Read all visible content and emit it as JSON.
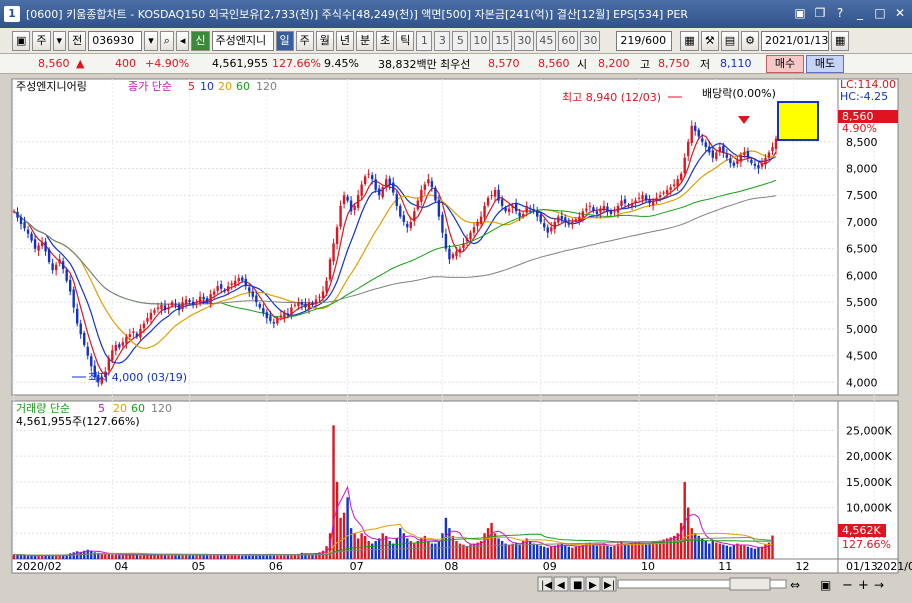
{
  "window": {
    "number": "1",
    "title": "[0600] 키움종합차트 - KOSDAQ150 외국인보유[2,733(천)] 주식수[48,249(천)] 액면[500] 자본금[241(억)] 결산[12월] EPS[534] PER"
  },
  "toolbar": {
    "market": "주",
    "jeon": "전",
    "code": "036930",
    "sin": "신",
    "stock_name": "주성엔지니",
    "periods": [
      "일",
      "주",
      "월",
      "년",
      "분",
      "초",
      "틱"
    ],
    "active_period": "일",
    "numbers": [
      "1",
      "3",
      "5",
      "10",
      "15",
      "30",
      "45",
      "60",
      "30"
    ],
    "count": "219/600",
    "date": "2021/01/13"
  },
  "quote": {
    "price": "8,560",
    "change": "400",
    "change_pct": "+4.90%",
    "volume": "4,561,955",
    "vol_ratio": "127.66%",
    "turnover": "9.45%",
    "amount": "38,832백만",
    "best_label": "최우선",
    "best_ask": "8,570",
    "best_bid": "8,560",
    "open_label": "시",
    "open": "8,200",
    "high_label": "고",
    "high": "8,750",
    "low_label": "저",
    "low": "8,110",
    "buy": "매수",
    "sell": "매도"
  },
  "price_panel": {
    "stock_label": "주성엔지니어링",
    "ma_label": "종가 단순",
    "ma_periods": [
      "5",
      "10",
      "20",
      "60",
      "120"
    ],
    "ma_colors": [
      "#e0141e",
      "#1232c8",
      "#e0a000",
      "#14a014",
      "#808080"
    ],
    "lc": "LC:114.00",
    "hc": "HC:-4.25",
    "current_price": "8,560",
    "current_pct": "4.90%",
    "high_annotation": "최고 8,940 (12/03)",
    "low_annotation": "최저 4,000 (03/19)",
    "dividend_annotation": "배당락(0.00%)"
  },
  "volume_panel": {
    "label": "거래량 단순",
    "ma_periods": [
      "5",
      "20",
      "60",
      "120"
    ],
    "ma_colors": [
      "#c814c8",
      "#e0a000",
      "#14a014",
      "#808080"
    ],
    "current": "4,561,955주(127.66%)",
    "current_short": "4,562K",
    "current_pct": "127.66%"
  },
  "chart_data": {
    "type": "candlestick",
    "price_ticks": [
      "8,500",
      "8,000",
      "7,500",
      "7,000",
      "6,500",
      "6,000",
      "5,500",
      "5,000",
      "4,500",
      "4,000"
    ],
    "price_tick_values": [
      8500,
      8000,
      7500,
      7000,
      6500,
      6000,
      5500,
      5000,
      4500,
      4000
    ],
    "price_range": [
      3800,
      9300
    ],
    "volume_ticks": [
      "25,000K",
      "20,000K",
      "15,000K",
      "10,000K",
      "5,000K"
    ],
    "volume_tick_values": [
      25000,
      20000,
      15000,
      10000,
      5000
    ],
    "volume_range": [
      0,
      28000
    ],
    "x_labels": [
      "2020/02",
      "04",
      "05",
      "06",
      "07",
      "08",
      "09",
      "10",
      "11",
      "12",
      "2021/01"
    ],
    "x_label_index": [
      0,
      28,
      50,
      72,
      95,
      122,
      150,
      178,
      200,
      222,
      245
    ],
    "right_x_label": "01/13",
    "close": [
      7200,
      7080,
      6960,
      6880,
      6780,
      6650,
      6500,
      6560,
      6620,
      6450,
      6250,
      6100,
      6200,
      6300,
      6120,
      5900,
      5700,
      5400,
      5100,
      4900,
      4700,
      4500,
      4300,
      4100,
      4000,
      4100,
      4200,
      4450,
      4600,
      4700,
      4650,
      4750,
      4850,
      4900,
      4950,
      4850,
      5000,
      5100,
      5200,
      5300,
      5350,
      5400,
      5450,
      5350,
      5400,
      5500,
      5450,
      5350,
      5500,
      5550,
      5500,
      5450,
      5500,
      5600,
      5550,
      5500,
      5650,
      5700,
      5800,
      5750,
      5700,
      5800,
      5850,
      5900,
      5950,
      5900,
      5800,
      5700,
      5600,
      5500,
      5400,
      5300,
      5200,
      5150,
      5100,
      5200,
      5250,
      5300,
      5250,
      5400,
      5450,
      5500,
      5450,
      5400,
      5500,
      5450,
      5550,
      5600,
      5700,
      5900,
      6300,
      6600,
      6900,
      7300,
      7500,
      7400,
      7200,
      7300,
      7500,
      7700,
      7850,
      7900,
      7800,
      7600,
      7500,
      7650,
      7800,
      7700,
      7550,
      7300,
      7100,
      7000,
      6900,
      7000,
      7200,
      7400,
      7600,
      7700,
      7800,
      7650,
      7400,
      7100,
      6800,
      6500,
      6300,
      6400,
      6450,
      6500,
      6600,
      6700,
      6800,
      6900,
      7000,
      7100,
      7300,
      7450,
      7500,
      7600,
      7400,
      7300,
      7200,
      7250,
      7300,
      7200,
      7100,
      7150,
      7300,
      7250,
      7200,
      7100,
      7000,
      6900,
      6800,
      6900,
      7000,
      7100,
      7050,
      7000,
      6950,
      7000,
      7050,
      7100,
      7200,
      7250,
      7300,
      7200,
      7150,
      7250,
      7300,
      7200,
      7150,
      7200,
      7300,
      7400,
      7350,
      7300,
      7350,
      7400,
      7450,
      7500,
      7400,
      7350,
      7400,
      7450,
      7500,
      7550,
      7600,
      7650,
      7700,
      7800,
      7900,
      8200,
      8500,
      8800,
      8700,
      8600,
      8500,
      8400,
      8300,
      8200,
      8300,
      8400,
      8300,
      8200,
      8100,
      8050,
      8150,
      8250,
      8300,
      8200,
      8100,
      8050,
      8000,
      8100,
      8200,
      8300,
      8400,
      8560
    ],
    "volume": [
      900,
      800,
      750,
      700,
      650,
      700,
      650,
      600,
      700,
      650,
      750,
      800,
      700,
      650,
      800,
      900,
      1100,
      1300,
      1500,
      1400,
      1600,
      1800,
      1500,
      1300,
      1200,
      1100,
      1000,
      900,
      850,
      800,
      750,
      700,
      800,
      850,
      900,
      800,
      700,
      750,
      800,
      850,
      900,
      850,
      800,
      750,
      700,
      800,
      850,
      900,
      800,
      750,
      700,
      700,
      750,
      800,
      850,
      800,
      750,
      700,
      800,
      850,
      900,
      850,
      800,
      750,
      700,
      650,
      700,
      750,
      700,
      650,
      700,
      750,
      800,
      850,
      900,
      800,
      750,
      700,
      800,
      850,
      900,
      1000,
      1200,
      1100,
      1000,
      900,
      1100,
      1300,
      1600,
      2500,
      5000,
      26000,
      15000,
      8000,
      9000,
      12000,
      6000,
      5000,
      4000,
      5000,
      4500,
      3500,
      3000,
      3500,
      4000,
      5000,
      4500,
      3500,
      3000,
      4000,
      6000,
      5000,
      4000,
      3500,
      3000,
      3500,
      4000,
      4500,
      3500,
      3000,
      3000,
      3500,
      5000,
      8000,
      6000,
      4500,
      3500,
      3000,
      2800,
      2500,
      2800,
      3000,
      3200,
      3500,
      5000,
      6000,
      7000,
      5000,
      4000,
      3500,
      3000,
      2800,
      3000,
      3200,
      2800,
      3500,
      4000,
      3500,
      3000,
      2800,
      2600,
      2400,
      2200,
      2400,
      2600,
      2800,
      3000,
      2600,
      2400,
      2200,
      2400,
      2600,
      2800,
      3000,
      3200,
      2800,
      2600,
      2800,
      3000,
      2600,
      2400,
      2600,
      3000,
      3500,
      3000,
      2800,
      3000,
      3200,
      3400,
      3000,
      2800,
      3000,
      3200,
      3400,
      3600,
      3800,
      4000,
      4200,
      4500,
      5000,
      7000,
      15000,
      10000,
      6000,
      5000,
      4500,
      4000,
      3500,
      3000,
      3500,
      3200,
      3000,
      2800,
      2600,
      2400,
      2800,
      3000,
      2800,
      2600,
      2400,
      2200,
      2000,
      2200,
      2400,
      2800,
      3200,
      4562
    ]
  }
}
